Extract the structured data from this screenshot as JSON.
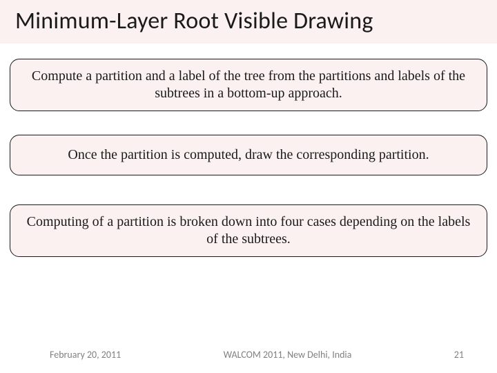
{
  "slide": {
    "title": "Minimum-Layer Root Visible Drawing",
    "blocks": [
      "Compute a partition and a label of the tree from the partitions and labels of the subtrees in a bottom-up approach.",
      "Once the partition is computed, draw the corresponding partition.",
      "Computing of a partition is broken down into four cases depending on the labels of the subtrees."
    ]
  },
  "footer": {
    "date": "February 20, 2011",
    "venue": "WALCOM 2011, New Delhi, India",
    "page": "21"
  }
}
